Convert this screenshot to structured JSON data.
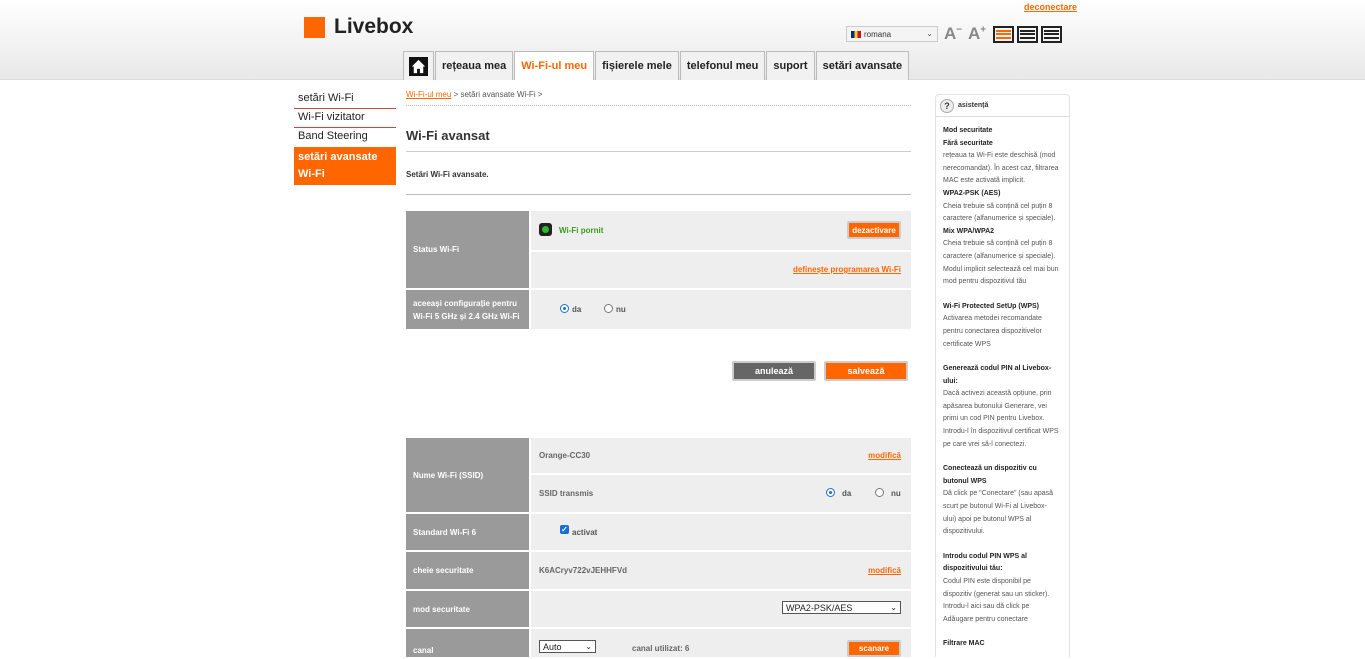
{
  "header": {
    "logo_text": "Livebox",
    "disconnect": "deconectare",
    "language": "romana",
    "font_decrease": "A",
    "font_increase": "A",
    "font_decrease_sign": "−",
    "font_increase_sign": "+"
  },
  "nav": {
    "items": [
      {
        "label": "rețeaua mea"
      },
      {
        "label": "Wi-Fi-ul meu"
      },
      {
        "label": "fișierele mele"
      },
      {
        "label": "telefonul meu"
      },
      {
        "label": "suport"
      },
      {
        "label": "setări avansate"
      }
    ]
  },
  "sidebar": {
    "items": [
      {
        "label": "setări Wi-Fi"
      },
      {
        "label": "Wi-Fi vizitator"
      },
      {
        "label": "Band Steering"
      },
      {
        "label": "setări avansate Wi-Fi"
      }
    ]
  },
  "breadcrumb": {
    "link": "Wi-Fi-ul meu",
    "rest": " > setări avansate Wi-Fi >"
  },
  "page": {
    "title": "Wi-Fi avansat",
    "intro": "Setări Wi-Fi avansate."
  },
  "status": {
    "label": "Status Wi-Fi",
    "state": "Wi-Fi pornit",
    "disable_button": "dezactivare",
    "schedule_link": "definește programarea Wi-Fi"
  },
  "same_config": {
    "label": "aceeași configurație pentru Wi-Fi 5 GHz și 2.4 GHz Wi-Fi",
    "yes": "da",
    "no": "nu"
  },
  "actions": {
    "cancel": "anulează",
    "save": "salvează"
  },
  "ssid": {
    "label": "Nume Wi-Fi (SSID)",
    "value": "Orange-CC30",
    "modify": "modifică",
    "transmit_label": "SSID transmis",
    "yes": "da",
    "no": "nu"
  },
  "wifi6": {
    "label": "Standard Wi-Fi 6",
    "check_label": "activat",
    "check_mark": "✓"
  },
  "key": {
    "label": "cheie securitate",
    "value": "K6ACryv722vJEHHFVd",
    "modify": "modifică"
  },
  "security": {
    "label": "mod securitate",
    "selected": "WPA2-PSK/AES",
    "arrow": "⌄"
  },
  "channel": {
    "label": "canal",
    "selected": "Auto",
    "used": "canal utilizat: 6",
    "scan": "scanare",
    "arrow": "⌄"
  },
  "help": {
    "title": "asistență",
    "icon": "?",
    "sections": [
      {
        "title": "Mod securitate",
        "lines": []
      },
      {
        "title": "Fără securitate",
        "lines": [
          "rețeaua ta Wi-Fi este deschisă (mod",
          "nerecomandat). În acest caz, filtrarea",
          "MAC este activată implicit."
        ]
      },
      {
        "title": "WPA2-PSK (AES)",
        "lines": [
          "Cheia trebuie să conțină cel puțin 8",
          "caractere (alfanumerice și speciale)."
        ]
      },
      {
        "title": "Mix WPA/WPA2",
        "lines": [
          "Cheia trebuie să conțină cel puțin 8",
          "caractere (alfanumerice și speciale).",
          "Modul implicit selectează cel mai bun",
          "mod pentru dispozitivul tău"
        ]
      },
      {
        "title": "Wi-Fi Protected SetUp (WPS)",
        "lines": [
          "Activarea metodei recomandate",
          "pentru conectarea dispozitivelor",
          "certificate WPS"
        ]
      },
      {
        "title": "Generează codul PIN al Livebox-ului:",
        "lines": [
          "Dacă activezi această opțiune, prin",
          "apăsarea butonului Generare, vei",
          "primi un cod PIN pentru Livebox.",
          "Introdu-l în dispozitivul certificat WPS",
          "pe care vrei să-l conectezi."
        ]
      },
      {
        "title": "Conectează un dispozitiv cu butonul WPS",
        "lines": [
          "Dă click pe \"Conectare\" (sau apasă",
          "scurt pe butonul Wi-Fi al Livebox-",
          "ului) apoi pe butonul WPS al",
          "dispozitivului."
        ]
      },
      {
        "title": "Introdu codul PIN WPS al dispozitivului tău:",
        "lines": [
          "Codul PIN este disponibil pe",
          "dispozitiv (generat sau un sticker).",
          "Introdu-l aici sau dă click pe",
          "Adăugare pentru conectare"
        ]
      },
      {
        "title": "Filtrare MAC",
        "lines": []
      }
    ]
  }
}
